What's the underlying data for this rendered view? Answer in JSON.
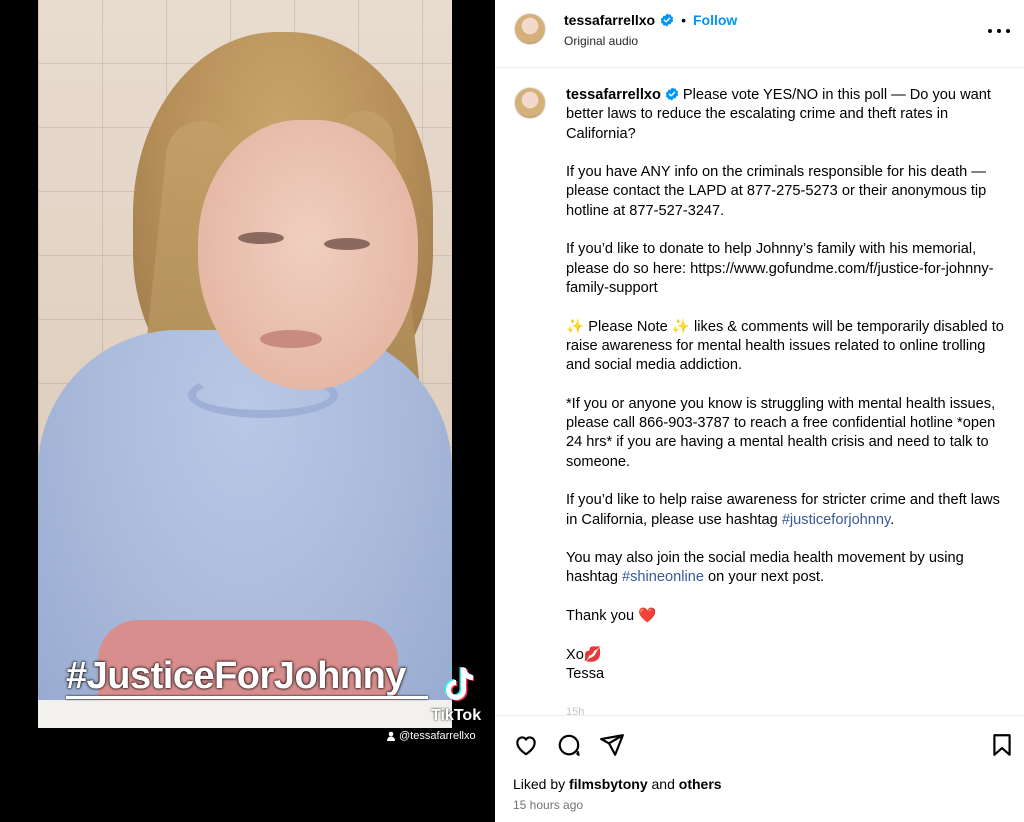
{
  "media": {
    "hashtag_overlay": "#JusticeForJohnny",
    "tiktok_label": "TikTok",
    "tiktok_handle": "@tessafarrellxo"
  },
  "header": {
    "username": "tessafarrellxo",
    "separator": "•",
    "follow_label": "Follow",
    "audio_label": "Original audio"
  },
  "caption": {
    "username": "tessafarrellxo",
    "p1": "Please vote YES/NO in this poll — Do you want better laws to reduce the escalating crime and theft rates in California?",
    "p2": "If you have ANY info on the criminals responsible for his death — please contact the LAPD at 877-275-5273 or their anonymous tip hotline at 877-527-3247.",
    "p3": "If you’d like to donate to help Johnny’s family with his memorial, please do so here: https://www.gofundme.com/f/justice-for-johnny-family-support",
    "p4_sparkle": "✨",
    "p4_a": "Please Note",
    "p4_b": "likes & comments will be temporarily disabled to raise awareness for mental health issues related to online trolling and social media addiction.",
    "p5": "*If you or anyone you know is struggling with mental health issues, please call 866-903-3787 to reach a free confidential hotline *open 24 hrs* if you are having a mental health crisis and need to talk to someone.",
    "p6_a": "If you’d like to help raise awareness for stricter crime and theft laws in California, please use hashtag",
    "p6_tag": "#justiceforjohnny",
    "p6_end": ".",
    "p7_a": "You may also join the social media health movement by using hashtag",
    "p7_tag": "#shineonline",
    "p7_b": "on your next post.",
    "thanks": "Thank you",
    "heart": "❤️",
    "signoff": "Xo",
    "lips": "💋",
    "name": "Tessa",
    "truncated_time": "15h"
  },
  "footer": {
    "liked_by_prefix": "Liked by",
    "liked_by_user": "filmsbytony",
    "liked_by_and": "and",
    "liked_by_others": "others",
    "timestamp": "15 hours ago"
  },
  "icons": {
    "like": "heart-outline-icon",
    "comment": "comment-bubble-icon",
    "share": "paper-plane-icon",
    "save": "bookmark-icon",
    "more": "more-options-icon",
    "verified": "verified-badge-icon"
  },
  "colors": {
    "follow": "#0095f6",
    "hashtag_link": "#385898",
    "verified": "#0095f6",
    "timestamp": "#737373"
  }
}
